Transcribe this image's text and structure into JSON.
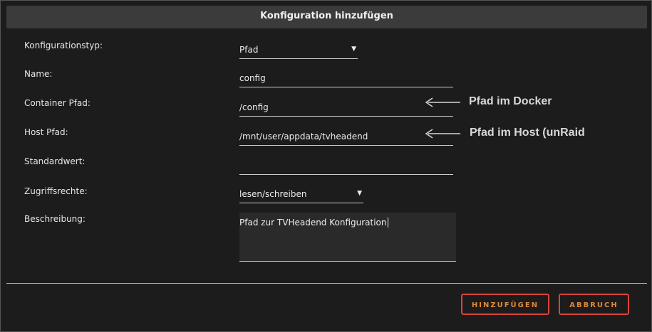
{
  "dialog": {
    "title": "Konfiguration hinzufügen"
  },
  "form": {
    "type_label": "Konfigurationstyp:",
    "type_value": "Pfad",
    "name_label": "Name:",
    "name_value": "config",
    "container_label": "Container Pfad:",
    "container_value": "/config",
    "host_label": "Host Pfad:",
    "host_value": "/mnt/user/appdata/tvheadend",
    "default_label": "Standardwert:",
    "default_value": "",
    "access_label": "Zugriffsrechte:",
    "access_value": "lesen/schreiben",
    "desc_label": "Beschreibung:",
    "desc_value": "Pfad zur TVHeadend Konfiguration"
  },
  "annotations": {
    "docker": "Pfad im Docker",
    "host": "Pfad im Host (unRaid"
  },
  "buttons": {
    "add": "HINZUFÜGEN",
    "cancel": "ABBRUCH"
  },
  "colors": {
    "accent_border": "#d9443a",
    "accent_text": "#e0883a",
    "background": "#1c1c1c",
    "titlebar": "#3b3b3b"
  },
  "icons": {
    "dropdown": "caret-down-icon",
    "annotation_arrow": "arrow-left-icon"
  }
}
